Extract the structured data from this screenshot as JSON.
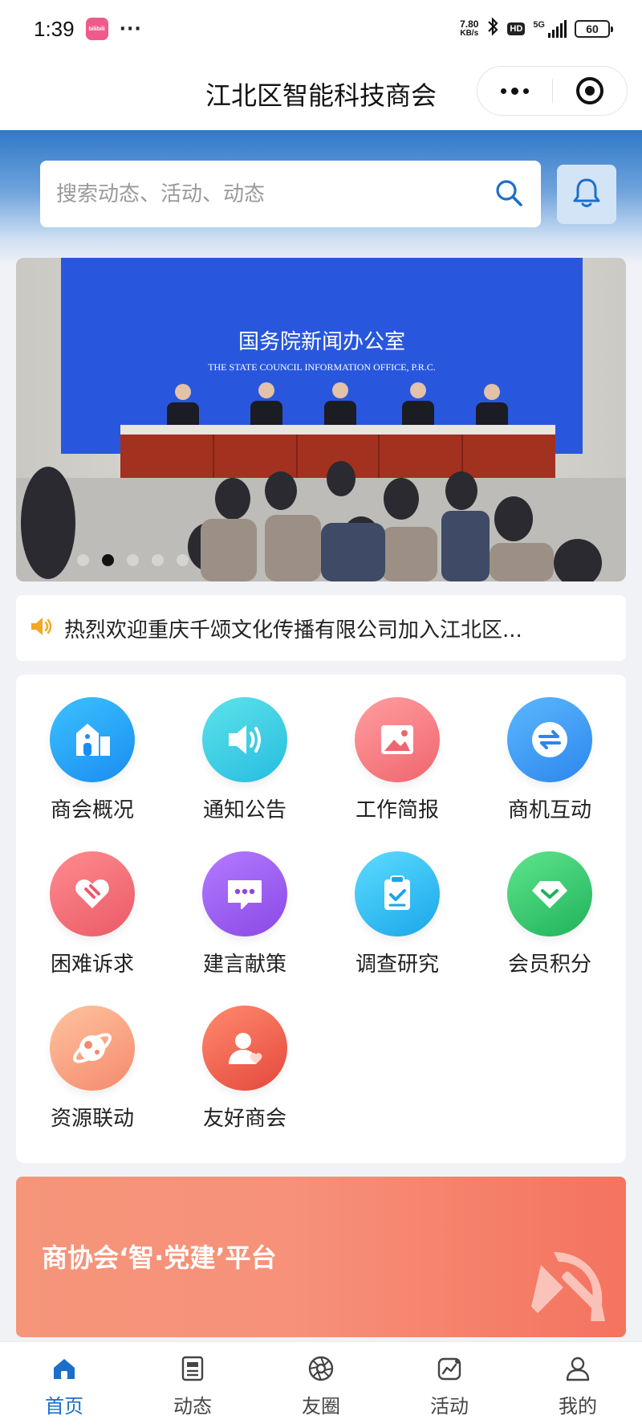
{
  "status_bar": {
    "time": "1:39",
    "app_badge": "bilibili",
    "more": "···",
    "net_speed_value": "7.80",
    "net_speed_unit": "KB/s",
    "hd": "HD",
    "network": "5G",
    "battery": "60"
  },
  "nav": {
    "title": "江北区智能科技商会"
  },
  "search": {
    "placeholder": "搜索动态、活动、动态"
  },
  "banner": {
    "backdrop_cn": "国务院新闻办公室",
    "backdrop_en": "THE STATE COUNCIL INFORMATION OFFICE, P.R.C.",
    "slide_count": 5,
    "active_index": 1
  },
  "notice": {
    "icon": "speaker-icon",
    "text": "热烈欢迎重庆千颂文化传播有限公司加入江北区..."
  },
  "menu": [
    {
      "label": "商会概况",
      "icon": "building-icon",
      "color": "#1a9bf0"
    },
    {
      "label": "通知公告",
      "icon": "announcement-icon",
      "color": "#2fc8dd"
    },
    {
      "label": "工作简报",
      "icon": "image-icon",
      "color": "#f3797f"
    },
    {
      "label": "商机互动",
      "icon": "exchange-icon",
      "color": "#3a98f2"
    },
    {
      "label": "困难诉求",
      "icon": "heart-link-icon",
      "color": "#f0676f"
    },
    {
      "label": "建言献策",
      "icon": "chat-icon",
      "color": "#9d5ef0"
    },
    {
      "label": "调查研究",
      "icon": "clipboard-icon",
      "color": "#29b6ec"
    },
    {
      "label": "会员积分",
      "icon": "diamond-icon",
      "color": "#2ec46d"
    },
    {
      "label": "资源联动",
      "icon": "planet-icon",
      "color": "#f79a76"
    },
    {
      "label": "友好商会",
      "icon": "user-heart-icon",
      "color": "#f06652"
    }
  ],
  "party_banner": {
    "title": "商协会‘智·党建’平台"
  },
  "tabs": [
    {
      "label": "首页",
      "icon": "home-icon",
      "active": true
    },
    {
      "label": "动态",
      "icon": "news-icon",
      "active": false
    },
    {
      "label": "友圈",
      "icon": "aperture-icon",
      "active": false
    },
    {
      "label": "活动",
      "icon": "activity-icon",
      "active": false
    },
    {
      "label": "我的",
      "icon": "user-icon",
      "active": false
    }
  ],
  "colors": {
    "primary": "#1b6fc9",
    "header_top": "#2f79c8",
    "page_bg": "#f1f2f6",
    "party_red": "#f4735f"
  }
}
